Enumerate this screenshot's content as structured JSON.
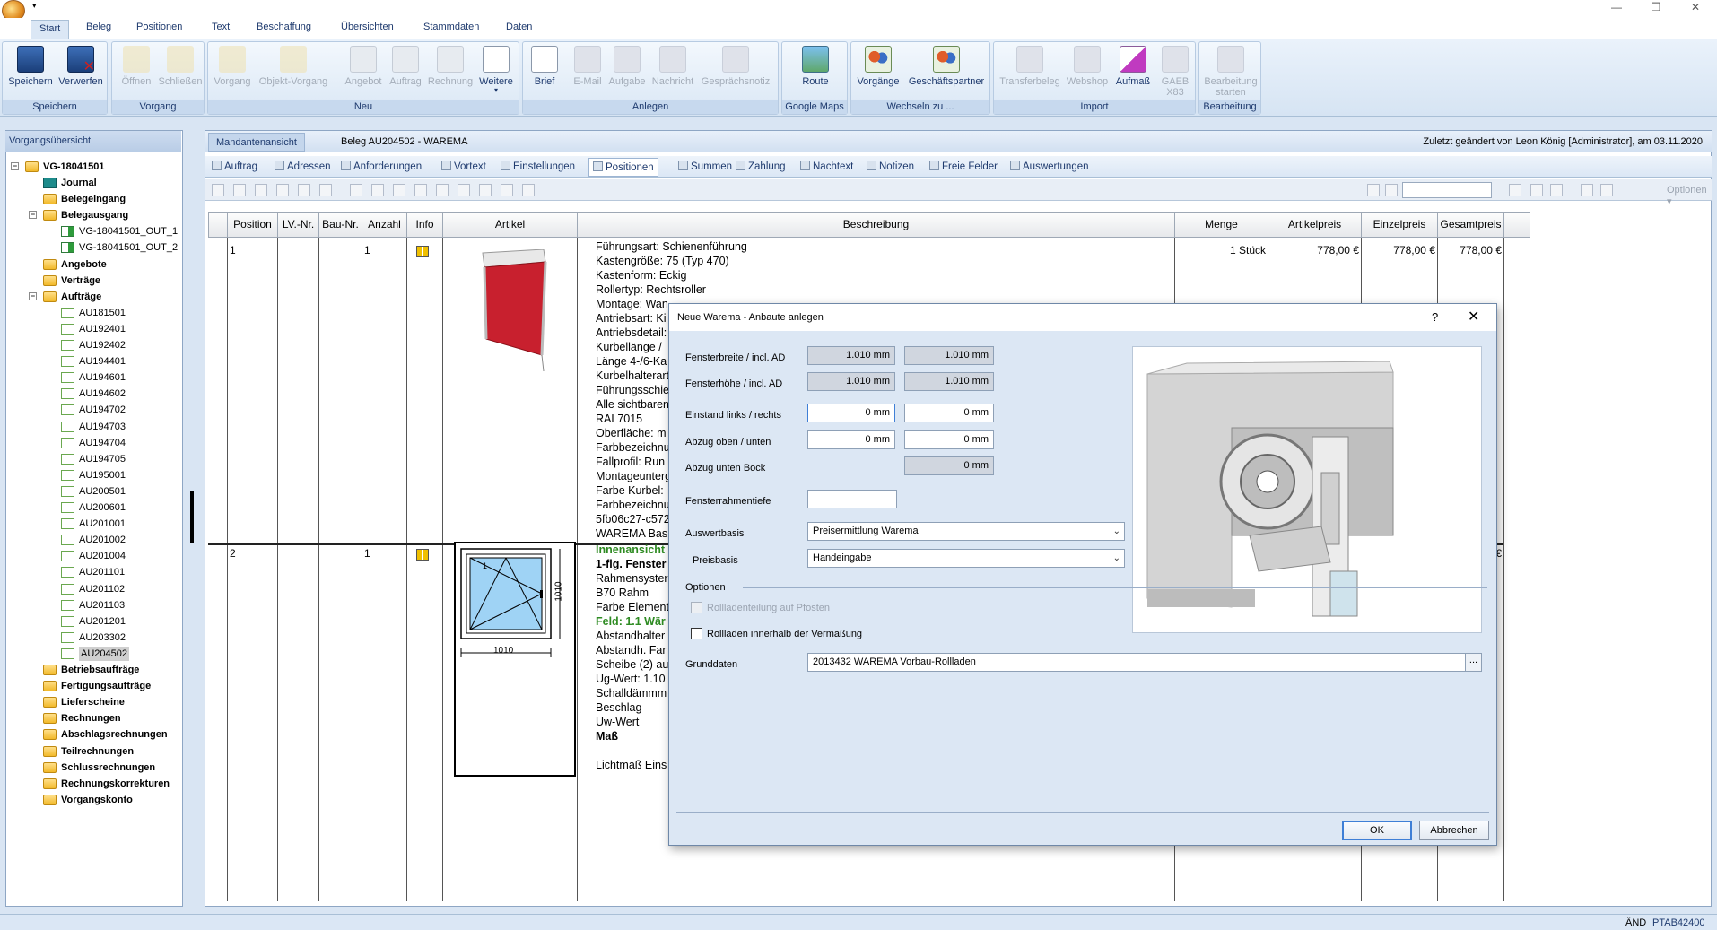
{
  "ribbon_tabs": [
    "Start",
    "Beleg",
    "Positionen",
    "Text",
    "Beschaffung",
    "Übersichten",
    "Stammdaten",
    "Daten"
  ],
  "ribbon_groups": {
    "speichern": {
      "label": "Speichern",
      "buttons": [
        "Speichern",
        "Verwerfen"
      ]
    },
    "vorgang": {
      "label": "Vorgang",
      "buttons": [
        "Öffnen",
        "Schließen"
      ]
    },
    "neu": {
      "label": "Neu",
      "buttons": [
        "Vorgang",
        "Objekt-Vorgang",
        "Angebot",
        "Auftrag",
        "Rechnung",
        "Weitere"
      ]
    },
    "anlegen": {
      "label": "Anlegen",
      "buttons": [
        "Brief",
        "E-Mail",
        "Aufgabe",
        "Nachricht",
        "Gesprächsnotiz"
      ]
    },
    "google": {
      "label": "Google Maps",
      "buttons": [
        "Route"
      ]
    },
    "wechseln": {
      "label": "Wechseln zu ...",
      "buttons": [
        "Vorgänge",
        "Geschäftspartner"
      ]
    },
    "import": {
      "label": "Import",
      "buttons": [
        "Transferbeleg",
        "Webshop",
        "Aufmaß",
        "GAEB",
        "X83"
      ]
    },
    "bearbeitung": {
      "label": "Bearbeitung",
      "buttons": [
        "Bearbeitung",
        "starten"
      ]
    }
  },
  "left_panel": {
    "header": "Vorgangsübersicht",
    "root": "VG-18041501",
    "items": [
      {
        "label": "Journal",
        "bold": true
      },
      {
        "label": "Belegeingang",
        "bold": true
      },
      {
        "label": "Belegausgang",
        "bold": true
      },
      {
        "label": "VG-18041501_OUT_1",
        "bold": false
      },
      {
        "label": "VG-18041501_OUT_2",
        "bold": false
      },
      {
        "label": "Angebote",
        "bold": true
      },
      {
        "label": "Verträge",
        "bold": true
      },
      {
        "label": "Aufträge",
        "bold": true
      },
      {
        "label": "AU181501"
      },
      {
        "label": "AU192401"
      },
      {
        "label": "AU192402"
      },
      {
        "label": "AU194401"
      },
      {
        "label": "AU194601"
      },
      {
        "label": "AU194602"
      },
      {
        "label": "AU194702"
      },
      {
        "label": "AU194703"
      },
      {
        "label": "AU194704"
      },
      {
        "label": "AU194705"
      },
      {
        "label": "AU195001"
      },
      {
        "label": "AU200501"
      },
      {
        "label": "AU200601"
      },
      {
        "label": "AU201001"
      },
      {
        "label": "AU201002"
      },
      {
        "label": "AU201004"
      },
      {
        "label": "AU201101"
      },
      {
        "label": "AU201102"
      },
      {
        "label": "AU201103"
      },
      {
        "label": "AU201201"
      },
      {
        "label": "AU203302"
      },
      {
        "label": "AU204502"
      },
      {
        "label": "Betriebsaufträge",
        "bold": true
      },
      {
        "label": "Fertigungsaufträge",
        "bold": true
      },
      {
        "label": "Lieferscheine",
        "bold": true
      },
      {
        "label": "Rechnungen",
        "bold": true
      },
      {
        "label": "Abschlagsrechnungen",
        "bold": true
      },
      {
        "label": "Teilrechnungen",
        "bold": true
      },
      {
        "label": "Schlussrechnungen",
        "bold": true
      },
      {
        "label": "Rechnungskorrekturen",
        "bold": true
      },
      {
        "label": "Vorgangskonto",
        "bold": true
      }
    ]
  },
  "main": {
    "tab": "Mandantenansicht",
    "beleg_title": "Beleg AU204502 - WAREMA",
    "last_changed": "Zuletzt geändert von Leon König [Administrator], am 03.11.2020",
    "subtabs": [
      "Auftrag",
      "Adressen",
      "Anforderungen",
      "Vortext",
      "Einstellungen",
      "Positionen",
      "Summen",
      "Zahlung",
      "Nachtext",
      "Notizen",
      "Freie Felder",
      "Auswertungen"
    ],
    "toolbar_optionen": "Optionen",
    "columns": [
      "Position",
      "LV.-Nr.",
      "Bau-Nr.",
      "Anzahl",
      "Info",
      "Artikel",
      "Beschreibung",
      "Menge",
      "Artikelpreis",
      "Einzelpreis",
      "Gesamtpreis"
    ],
    "rows": [
      {
        "position": "1",
        "anzahl": "1",
        "menge": "1 Stück",
        "artikelpreis": "778,00 €",
        "einzelpreis": "778,00 €",
        "gesamtpreis": "778,00 €",
        "description": [
          "Führungsart: Schienenführung",
          "Kastengröße: 75 (Typ 470)",
          "Kastenform: Eckig",
          "Rollertyp: Rechtsroller",
          "Montage: Wan",
          "Antriebsart: Ki",
          "Antriebsdetail:",
          "Kurbellänge / ",
          "Länge 4-/6-Ka",
          "Kurbelhalterart",
          "Führungsschie",
          "Alle sichtbaren",
          "RAL7015",
          "Oberfläche: m",
          "Farbbezeichnu",
          "Fallprofil: Run",
          "Montageunterg",
          "Farbe Kurbel: ",
          "Farbbezeichnu",
          "5fb06c27-c572",
          "WAREMA Bas"
        ]
      },
      {
        "position": "2",
        "anzahl": "1",
        "gesamtpreis": "80,25 €",
        "description": [
          "Innenansicht",
          "1-flg. Fenster",
          "Rahmensyster",
          "B70     Rahm",
          "Farbe Element",
          "Feld: 1.1 Wär",
          "Abstandhalter",
          "Abstandh. Far",
          "Scheibe (2) au",
          "Ug-Wert: 1.10",
          "Schalldämmm",
          "Beschlag",
          "Uw-Wert",
          "Maß",
          "",
          "Lichtmaß Eins"
        ],
        "window_width": "1010",
        "window_height": "1010",
        "window_field": "1"
      }
    ]
  },
  "dialog": {
    "title": "Neue Warema - Anbaute anlegen",
    "help": "?",
    "close": "✕",
    "fields": {
      "fensterbreite": {
        "label": "Fensterbreite / incl. AD",
        "v1": "1.010 mm",
        "v2": "1.010 mm"
      },
      "fensterhoehe": {
        "label": "Fensterhöhe / incl. AD",
        "v1": "1.010 mm",
        "v2": "1.010 mm"
      },
      "einstand": {
        "label": "Einstand links / rechts",
        "v1": "0 mm",
        "v2": "0 mm"
      },
      "abzug": {
        "label": "Abzug oben / unten",
        "v1": "0 mm",
        "v2": "0 mm"
      },
      "abzug_bock": {
        "label": "Abzug unten Bock",
        "v2": "0 mm"
      },
      "rahmentiefe": {
        "label": "Fensterrahmentiefe",
        "v1": ""
      },
      "auswertbasis": {
        "label": "Auswertbasis",
        "value": "Preisermittlung Warema"
      },
      "preisbasis": {
        "label": "Preisbasis",
        "value": "Handeingabe"
      }
    },
    "optionen_label": "Optionen",
    "checkbox1": "Rollladenteilung auf Pfosten",
    "checkbox2": "Rollladen innerhalb der Vermaßung",
    "grunddaten_label": "Grunddaten",
    "grunddaten_value": "2013432 WAREMA Vorbau-Rollladen",
    "ellipsis": "...",
    "ok": "OK",
    "cancel": "Abbrechen"
  },
  "status": {
    "and": "ÄND",
    "ptab": "PTAB42400"
  }
}
